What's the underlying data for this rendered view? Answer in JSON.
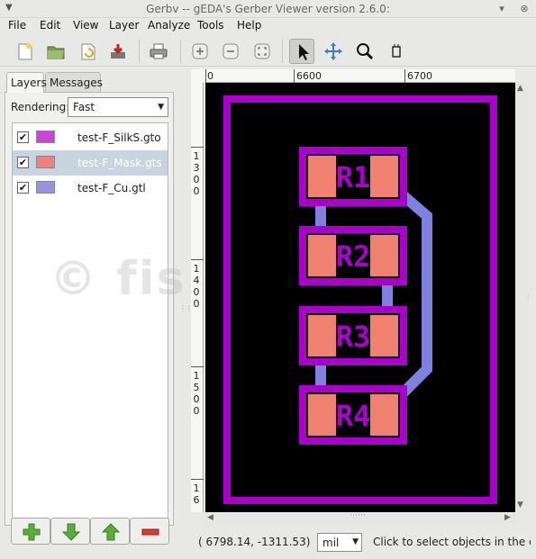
{
  "window": {
    "title": "Gerbv -- gEDA's Gerber Viewer version 2.6.0:"
  },
  "menu": [
    "File",
    "Edit",
    "View",
    "Layer",
    "Analyze",
    "Tools",
    "Help"
  ],
  "toolbar": {
    "icons": [
      "new-icon",
      "open-icon",
      "revert-icon",
      "save-icon",
      "print-icon",
      "zoom-in-icon",
      "zoom-out-icon",
      "zoom-fit-icon",
      "pointer-icon",
      "pan-icon",
      "zoom-icon",
      "measure-icon"
    ],
    "active": "pointer-icon"
  },
  "sidebar": {
    "tabs": [
      "Layers",
      "Messages"
    ],
    "selected_tab": "Layers",
    "rendering_label": "Rendering:",
    "rendering_value": "Fast",
    "layers": [
      {
        "name": "test-F_SilkS.gto",
        "color": "#cc44d8",
        "checked": true,
        "selected": false
      },
      {
        "name": "test-F_Mask.gts",
        "color": "#f08080",
        "checked": true,
        "selected": true
      },
      {
        "name": "test-F_Cu.gtl",
        "color": "#9a94e0",
        "checked": true,
        "selected": false
      }
    ]
  },
  "ruler": {
    "top_labels": [
      "0",
      "6600",
      "6700"
    ],
    "left_labels": [
      "1300",
      "1400",
      "1500",
      "16"
    ]
  },
  "board": {
    "components": [
      "R1",
      "R2",
      "R3",
      "R4"
    ],
    "colors": {
      "silk": "#aa00cc",
      "mask": "#f08070",
      "copper": "#8080e0",
      "background": "#000000"
    }
  },
  "status": {
    "coords": "( 6798.14, -1311.53)",
    "unit": "mil",
    "message": "Click to select objects in the c…"
  },
  "watermark": "© fis"
}
